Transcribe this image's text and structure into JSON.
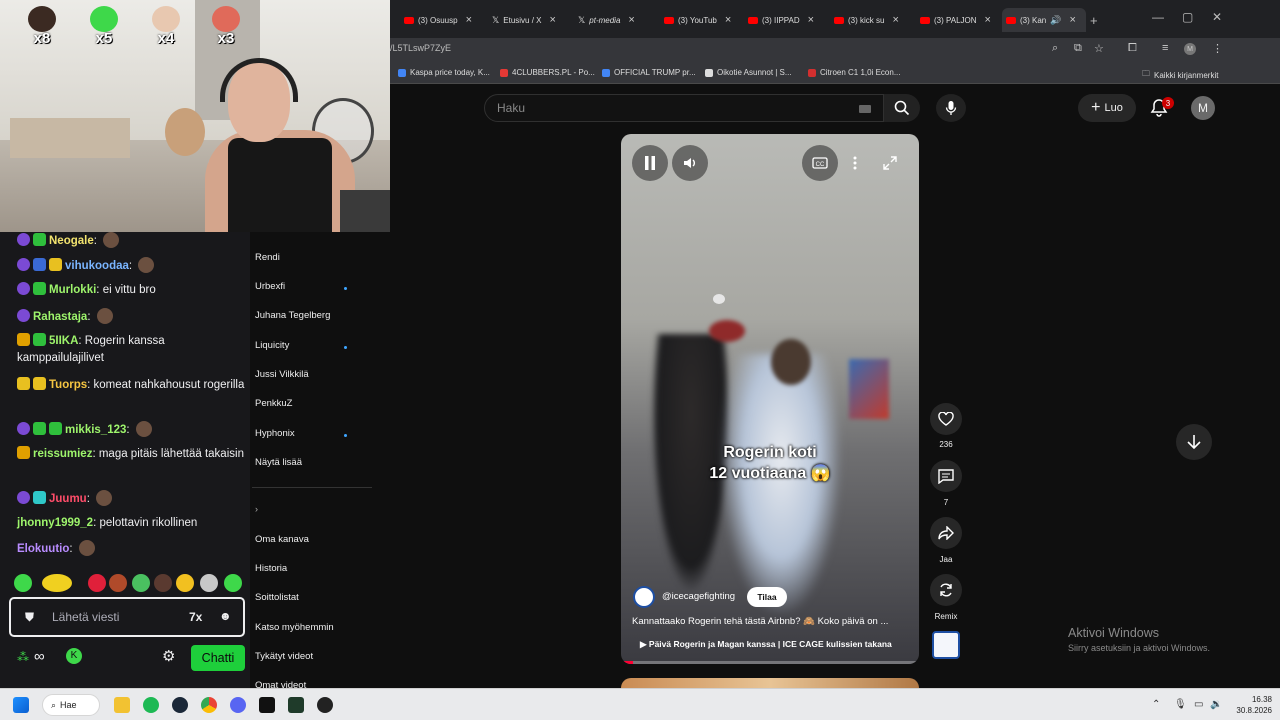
{
  "browser": {
    "tabs": [
      {
        "label": "(3) Osuusp"
      },
      {
        "label": "Etusivu / X"
      },
      {
        "label": "pt-media"
      },
      {
        "label": "(3) YouTub"
      },
      {
        "label": "(3) IIPPAD"
      },
      {
        "label": "(3) kick su"
      },
      {
        "label": "(3) PALJON"
      },
      {
        "label": "(3) Kan"
      }
    ],
    "new_tab": "+",
    "url": "/L5TLswP7ZyE",
    "bookmarks": [
      {
        "label": "Kaspa price today, K..."
      },
      {
        "label": "4CLUBBERS.PL - Po..."
      },
      {
        "label": "OFFICIAL TRUMP pr..."
      },
      {
        "label": "Oikotie Asunnot | S..."
      },
      {
        "label": "Citroen C1 1,0i Econ..."
      }
    ],
    "all_bookmarks": "Kaikki kirjanmerkit"
  },
  "youtube": {
    "search_placeholder": "Haku",
    "create_label": "Luo",
    "notification_count": "3",
    "avatar_letter": "M",
    "sidebar": {
      "channels": [
        {
          "label": "Rendi",
          "live": false
        },
        {
          "label": "Urbexfi",
          "live": true
        },
        {
          "label": "Juhana Tegelberg",
          "live": false
        },
        {
          "label": "Liquicity",
          "live": true
        },
        {
          "label": "Jussi Vilkkilä",
          "live": false
        },
        {
          "label": "PenkkuZ",
          "live": false
        },
        {
          "label": "Hyphonix",
          "live": true
        }
      ],
      "show_more": "Näytä lisää",
      "you_items": [
        {
          "label": "Oma kanava"
        },
        {
          "label": "Historia"
        },
        {
          "label": "Soittolistat"
        },
        {
          "label": "Katso myöhemmin"
        },
        {
          "label": "Tykätyt videot"
        },
        {
          "label": "Omat videot"
        }
      ]
    },
    "short": {
      "caption_line1": "Rogerin koti",
      "caption_line2": "12 vuotiaana 😱",
      "channel": "@icecagefighting",
      "subscribe_label": "Tilaa",
      "title": "Kannattaako Rogerin tehä tästä Airbnb? 🙈 Koko päivä on ...",
      "playlist": "Päivä Rogerin ja Magan kanssa | ICE CAGE kulissien takana",
      "progress": 0.04
    },
    "actions": {
      "likes": "236",
      "comments": "7",
      "share": "Jaa",
      "remix": "Remix"
    }
  },
  "windows_watermark": {
    "line1": "Aktivoi Windows",
    "line2": "Siirry asetuksiin ja aktivoi Windows."
  },
  "stream": {
    "hud": [
      {
        "mult": "x8",
        "color": "#3b2a22"
      },
      {
        "mult": "x5",
        "color": "#3ed84a"
      },
      {
        "mult": "x4",
        "color": "#e8c8b0"
      },
      {
        "mult": "x3",
        "color": "#e06a5a"
      }
    ],
    "chat": [
      {
        "badges": [
          "25",
          "g"
        ],
        "user": "Neogale",
        "color": "#f2e36e",
        "text": "",
        "emote": true
      },
      {
        "badges": [
          "30",
          "b",
          "y"
        ],
        "user": "vihukoodaa",
        "color": "#7ab5ff",
        "text": "",
        "emote": true
      },
      {
        "badges": [
          "32",
          "g"
        ],
        "user": "Murlokki",
        "color": "#9ef56c",
        "text": "ei vittu bro",
        "emote": false
      },
      {
        "badges": [
          "31"
        ],
        "user": "Rahastaja",
        "color": "#9ef56c",
        "text": "",
        "emote": true
      },
      {
        "badges": [
          "c",
          "g"
        ],
        "user": "5IIKA",
        "color": "#9ef56c",
        "text": "Rogerin kanssa kamppailulajilivet",
        "emote": false
      },
      {
        "badges": [
          "y",
          "y"
        ],
        "user": "Tuorps",
        "color": "#f5c542",
        "text": "komeat nahkahousut rogerilla",
        "emote": false
      },
      {
        "badges": [
          "50",
          "g",
          "g"
        ],
        "user": "mikkis_123",
        "color": "#9ef56c",
        "text": "",
        "emote": true
      },
      {
        "badges": [
          "c"
        ],
        "user": "reissumiez",
        "color": "#9ef56c",
        "text": "maga pitäis lähettää takaisin",
        "emote": false
      },
      {
        "badges": [
          "27",
          "t"
        ],
        "user": "Juumu",
        "color": "#ff4d6a",
        "text": "",
        "emote": true
      },
      {
        "badges": [],
        "user": "jhonny1999_2",
        "color": "#9ef56c",
        "text": "pelottavin rikollinen",
        "emote": false
      },
      {
        "badges": [],
        "user": "Elokuutio",
        "color": "#b98cff",
        "text": "",
        "emote": true
      }
    ],
    "chat_placeholder": "Lähetä viesti",
    "chat_button": "Chatti"
  },
  "taskbar": {
    "search_label": "Hae",
    "time": "16.38",
    "date": "30.8.2026"
  }
}
